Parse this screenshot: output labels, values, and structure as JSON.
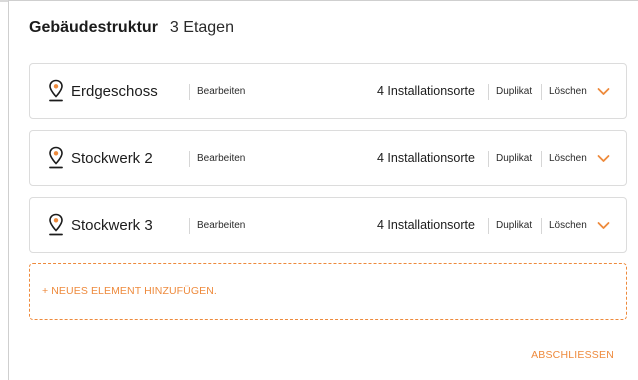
{
  "header": {
    "title": "Gebäudestruktur",
    "count": "3 Etagen"
  },
  "floors": [
    {
      "name": "Erdgeschoss",
      "edit": "Bearbeiten",
      "locations": "4 Installationsorte",
      "duplicate": "Duplikat",
      "delete": "Löschen"
    },
    {
      "name": "Stockwerk 2",
      "edit": "Bearbeiten",
      "locations": "4 Installationsorte",
      "duplicate": "Duplikat",
      "delete": "Löschen"
    },
    {
      "name": "Stockwerk 3",
      "edit": "Bearbeiten",
      "locations": "4 Installationsorte",
      "duplicate": "Duplikat",
      "delete": "Löschen"
    }
  ],
  "add_element": "+ NEUES ELEMENT HINZUFÜGEN.",
  "close": "ABSCHLIESSEN",
  "colors": {
    "accent": "#ee8a3c",
    "text": "#1c1c1c",
    "border": "#dcdcdc"
  },
  "icons": {
    "floor_pin": "location-pin-icon",
    "expand": "chevron-down-icon"
  }
}
